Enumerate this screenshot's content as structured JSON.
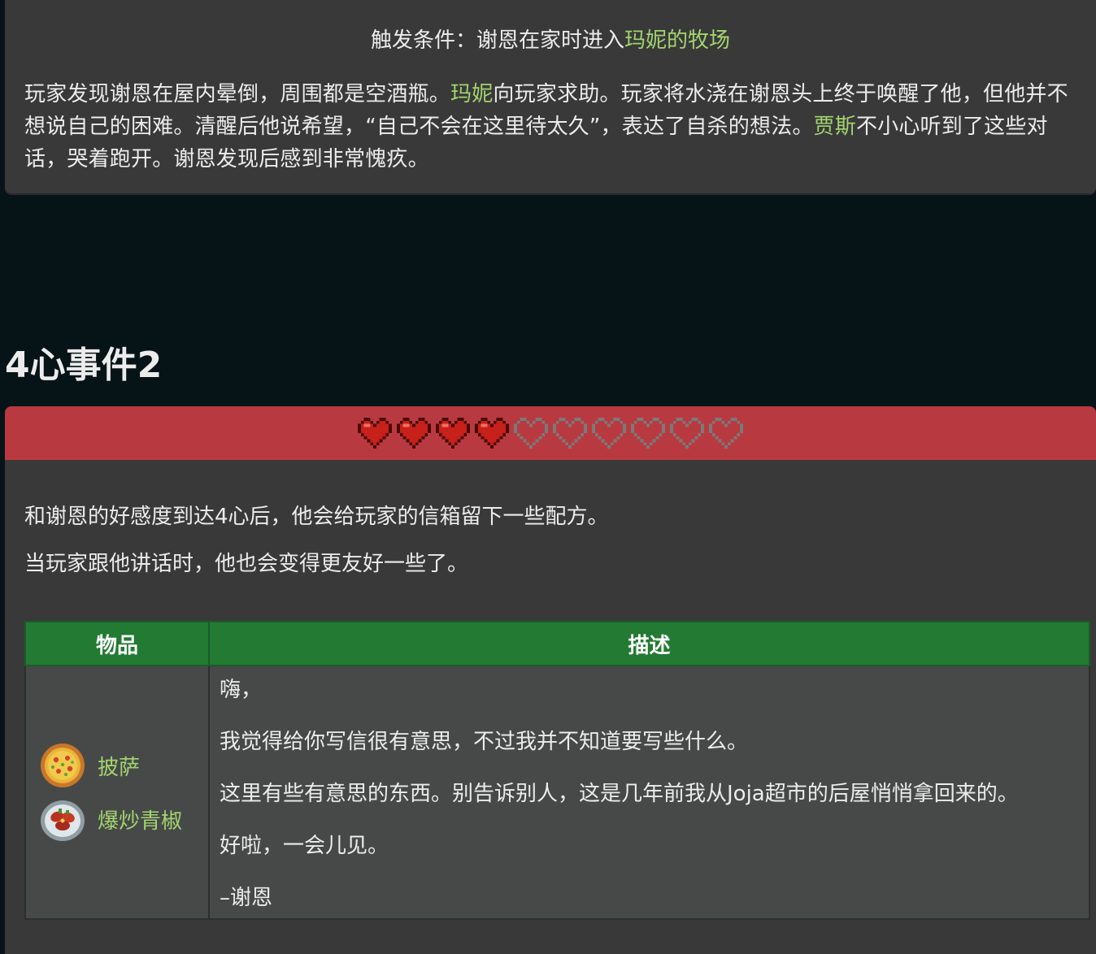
{
  "event1": {
    "trigger_prefix": "触发条件：谢恩在家时进入",
    "trigger_location": "玛妮的牧场",
    "text_part1": "玩家发现谢恩在屋内晕倒，周围都是空酒瓶。",
    "link_marnie": "玛妮",
    "text_part2": "向玩家求助。玩家将水浇在谢恩头上终于唤醒了他，但他并不想说自己的困难。清醒后他说希望，“自己不会在这里待太久”，表达了自杀的想法。",
    "link_jas": "贾斯",
    "text_part3": "不小心听到了这些对话，哭着跑开。谢恩发现后感到非常愧疚。"
  },
  "event2": {
    "heading": "4心事件2",
    "hearts": {
      "filled": 4,
      "total": 10,
      "filled_color": "#c8201a",
      "empty_color": "#7a7a7a"
    },
    "desc_line1": "和谢恩的好感度到达4心后，他会给玩家的信箱留下一些配方。",
    "desc_line2": "当玩家跟他讲话时，他也会变得更友好一些了。",
    "table": {
      "headers": [
        "物品",
        "描述"
      ],
      "items": [
        {
          "name": "披萨",
          "icon": "pizza-icon"
        },
        {
          "name": "爆炒青椒",
          "icon": "pepper-poppers-icon"
        }
      ],
      "letter": {
        "greeting": "嗨，",
        "p1": "我觉得给你写信很有意思，不过我并不知道要写些什么。",
        "p2": "这里有些有意思的东西。别告诉别人，这是几年前我从Joja超市的后屋悄悄拿回来的。",
        "p3": "好啦，一会儿见。",
        "signature": "–谢恩"
      }
    }
  },
  "colors": {
    "page_bg": "#061418",
    "card_bg": "#393939",
    "link": "#a3d46f",
    "heart_bar": "#b83a40",
    "table_header": "#237a33",
    "table_cell": "#474948"
  }
}
